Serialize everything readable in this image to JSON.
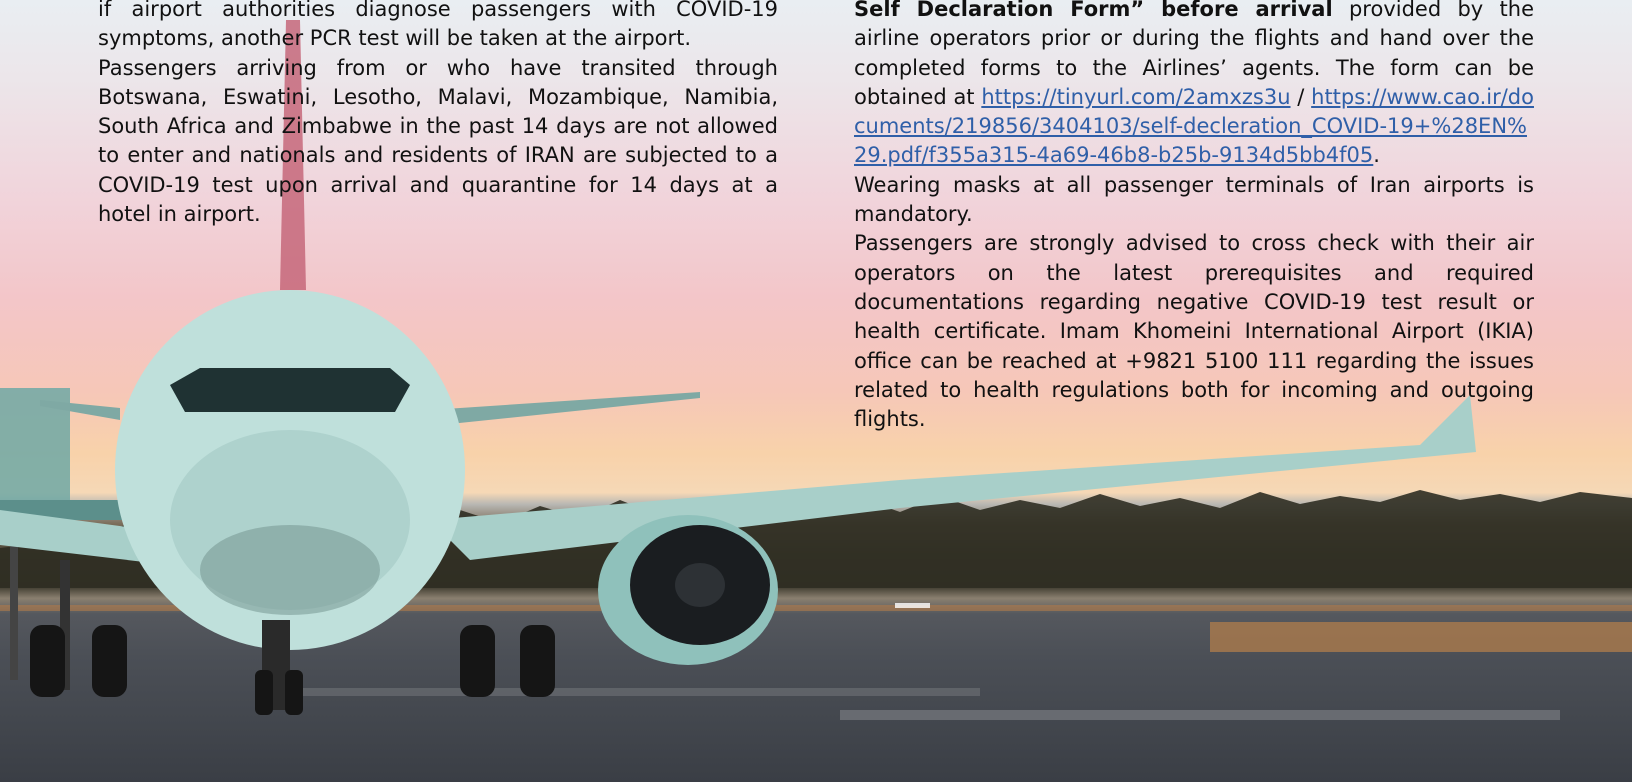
{
  "left_column": {
    "p1": "if airport authorities diagnose passengers with COVID-19 symptoms, another PCR test will be taken at the airport.",
    "p2": "Passengers arriving from or who have transited through Botswana, Eswatini, Lesotho, Malavi, Mozambique, Namibia, South Africa and Zimbabwe in the past 14 days are not allowed to enter and nationals and residents of IRAN are subjected to a COVID-19 test upon arrival and quarantine for 14 days at a hotel in airport."
  },
  "right_column": {
    "p1_bold": "Self Declaration Form” before arrival",
    "p1_text": " provided by the airline operators prior or during the flights and hand over the completed forms to the Airlines’ agents. The form can be obtained at ",
    "link1": "https://tinyurl.com/2amxzs3u",
    "separator": " / ",
    "link2": "https://www.cao.ir/documents/219856/3404103/self-decleration_COVID-19+%28EN%29.pdf/f355a315-4a69-46b8-b25b-9134d5bb4f05",
    "p1_end": ".",
    "p2": "Wearing masks at all passenger terminals of Iran airports is mandatory.",
    "p3": "Passengers are strongly advised to cross check with their air operators on the latest prerequisites and required documentations regarding negative COVID-19 test result or health certificate. Imam Khomeini International Airport (IKIA) office can be reached at +9821 5100 111 regarding the issues related to health regulations both for incoming and outgoing flights."
  },
  "colors": {
    "link": "#2f5fa8",
    "sky_pink": "#f3c6c9",
    "sky_orange": "#f8d2aa",
    "tarmac": "#43474e",
    "plane_body": "#b9dcd8"
  }
}
